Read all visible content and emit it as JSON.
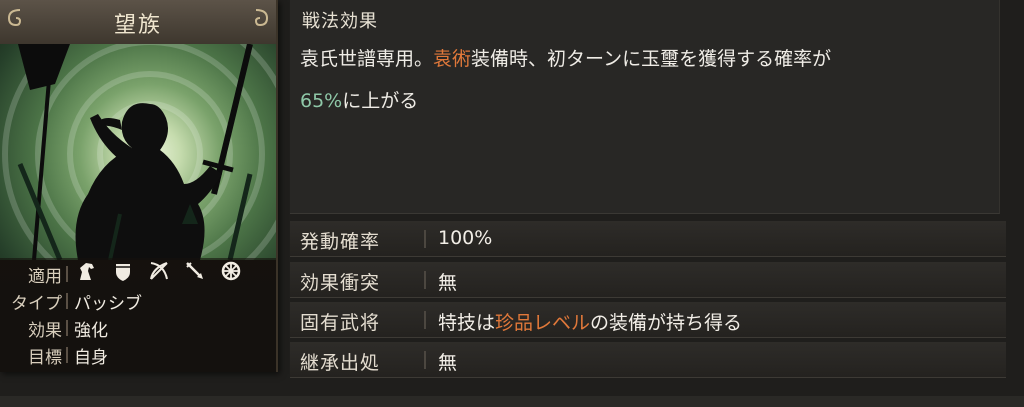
{
  "card": {
    "name": "望族",
    "info": [
      {
        "label": "適用",
        "icons": [
          "cavalry-icon",
          "shield-icon",
          "crossbow-icon",
          "spear-icon",
          "wheel-icon"
        ]
      },
      {
        "label": "タイプ",
        "value": "パッシブ"
      },
      {
        "label": "効果",
        "value": "強化"
      },
      {
        "label": "目標",
        "value": "自身"
      }
    ]
  },
  "effect": {
    "title": "戦法効果",
    "text_part1": "袁氏世譜専用。",
    "highlight_name": "袁術",
    "text_part2": "装備時、初ターンに玉璽を獲得する確率が",
    "highlight_value": "65%",
    "text_part3": "に上がる"
  },
  "attributes": [
    {
      "label": "発動確率",
      "value": "100%",
      "value_color": "#8fc8a8"
    },
    {
      "label": "効果衝突",
      "value": "無"
    },
    {
      "label": "固有武将",
      "value_part1": "特技は",
      "value_highlight": "珍品レベル",
      "value_part2": "の装備が持ち得る"
    },
    {
      "label": "継承出処",
      "value": "無"
    }
  ],
  "colors": {
    "highlight_orange": "#e0783a",
    "highlight_green": "#8fc8a8",
    "background": "#1f1e1c"
  }
}
